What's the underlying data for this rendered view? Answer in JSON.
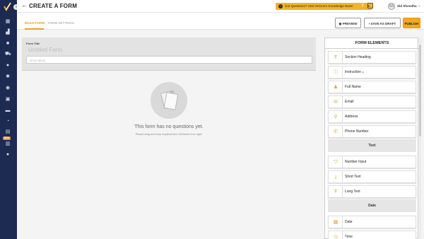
{
  "header": {
    "title": "CREATE A FORM",
    "banner": "Got Questions? Visit Verizon's Knowledge Base!",
    "user_initials": "SS",
    "user_name": "Sid Shrestha"
  },
  "tabs": [
    "BUILD FORM",
    "FORM SETTINGS"
  ],
  "actions": {
    "preview": "PREVIEW",
    "save_draft": "SAVE AS DRAFT",
    "publish": "PUBLISH"
  },
  "form": {
    "title_label": "Form Title",
    "title_placeholder": "Untitled Form",
    "description_placeholder": "Description"
  },
  "empty_state": {
    "title": "This form has no questions yet.",
    "subtitle": "Please drag and drop required form elements from right."
  },
  "sidebar": {
    "new_badge": "New"
  },
  "panel": {
    "title": "FORM ELEMENTS",
    "items": [
      {
        "label": "Section Heading",
        "icon": "section-heading-icon"
      },
      {
        "label": "Instruction",
        "icon": "info-icon"
      },
      {
        "label": "Full Name",
        "icon": "person-icon"
      },
      {
        "label": "Email",
        "icon": "email-icon"
      },
      {
        "label": "Address",
        "icon": "location-icon"
      },
      {
        "label": "Phone Number",
        "icon": "phone-icon"
      },
      {
        "section": "Text"
      },
      {
        "label": "Number Input",
        "icon": "number-icon"
      },
      {
        "label": "Short Text",
        "icon": "short-text-icon"
      },
      {
        "label": "Long Text",
        "icon": "long-text-icon"
      },
      {
        "section": "Date"
      },
      {
        "label": "Date",
        "icon": "calendar-icon"
      },
      {
        "label": "Time",
        "icon": "clock-icon"
      }
    ]
  },
  "colors": {
    "sidebar": "#1d2a52",
    "accent": "#f5a623",
    "banner": "#f6b127"
  }
}
